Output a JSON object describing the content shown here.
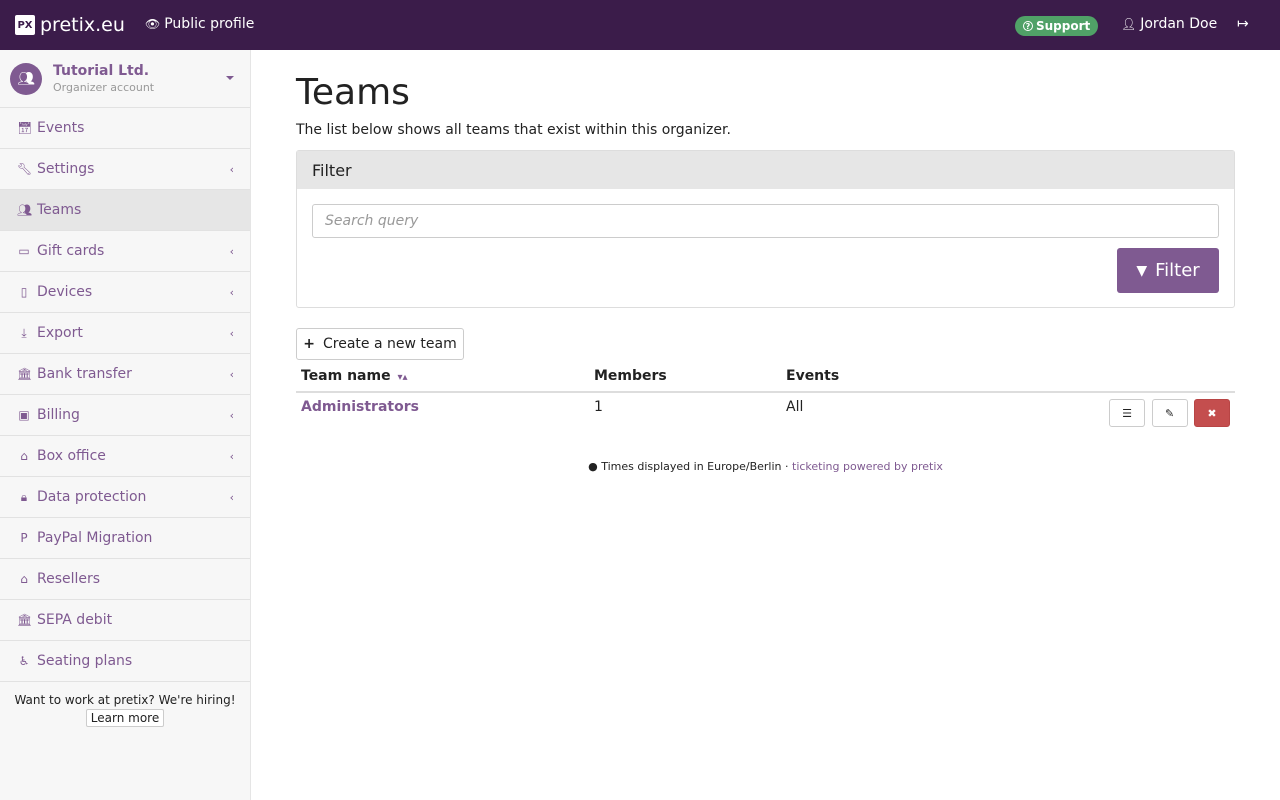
{
  "topbar": {
    "brand": "pretix.eu",
    "public_profile": "Public profile",
    "support": "Support",
    "user": "Jordan Doe"
  },
  "organizer": {
    "name": "Tutorial Ltd.",
    "subtitle": "Organizer account"
  },
  "sidebar": {
    "items": [
      {
        "label": "Events",
        "icon": "calendar-icon",
        "has_submenu": false
      },
      {
        "label": "Settings",
        "icon": "wrench-icon",
        "has_submenu": true
      },
      {
        "label": "Teams",
        "icon": "group-icon",
        "has_submenu": false,
        "active": true
      },
      {
        "label": "Gift cards",
        "icon": "credit-card-icon",
        "has_submenu": true
      },
      {
        "label": "Devices",
        "icon": "tablet-icon",
        "has_submenu": true
      },
      {
        "label": "Export",
        "icon": "download-icon",
        "has_submenu": true
      },
      {
        "label": "Bank transfer",
        "icon": "bank-icon",
        "has_submenu": true
      },
      {
        "label": "Billing",
        "icon": "money-icon",
        "has_submenu": true
      },
      {
        "label": "Box office",
        "icon": "basket-icon",
        "has_submenu": true
      },
      {
        "label": "Data protection",
        "icon": "lock-icon",
        "has_submenu": true
      },
      {
        "label": "PayPal Migration",
        "icon": "paypal-icon",
        "has_submenu": false
      },
      {
        "label": "Resellers",
        "icon": "home-icon",
        "has_submenu": false
      },
      {
        "label": "SEPA debit",
        "icon": "bank-icon",
        "has_submenu": false
      },
      {
        "label": "Seating plans",
        "icon": "wheelchair-icon",
        "has_submenu": false
      }
    ],
    "hiring_text": "Want to work at pretix? We're hiring!",
    "hiring_link": "Learn more"
  },
  "main": {
    "title": "Teams",
    "description": "The list below shows all teams that exist within this organizer.",
    "filter": {
      "heading": "Filter",
      "search_placeholder": "Search query",
      "button": "Filter"
    },
    "create_button": "Create a new team",
    "table": {
      "headers": [
        "Team name",
        "Members",
        "Events"
      ],
      "rows": [
        {
          "name": "Administrators",
          "members": "1",
          "events": "All"
        }
      ]
    },
    "footer": {
      "timezone": "Times displayed in Europe/Berlin",
      "separator": "·",
      "powered": "ticketing powered by pretix"
    }
  },
  "colors": {
    "topbar_bg": "#3b1c4a",
    "accent": "#7f5a91",
    "support_badge": "#50a167",
    "danger": "#c44e4e"
  }
}
